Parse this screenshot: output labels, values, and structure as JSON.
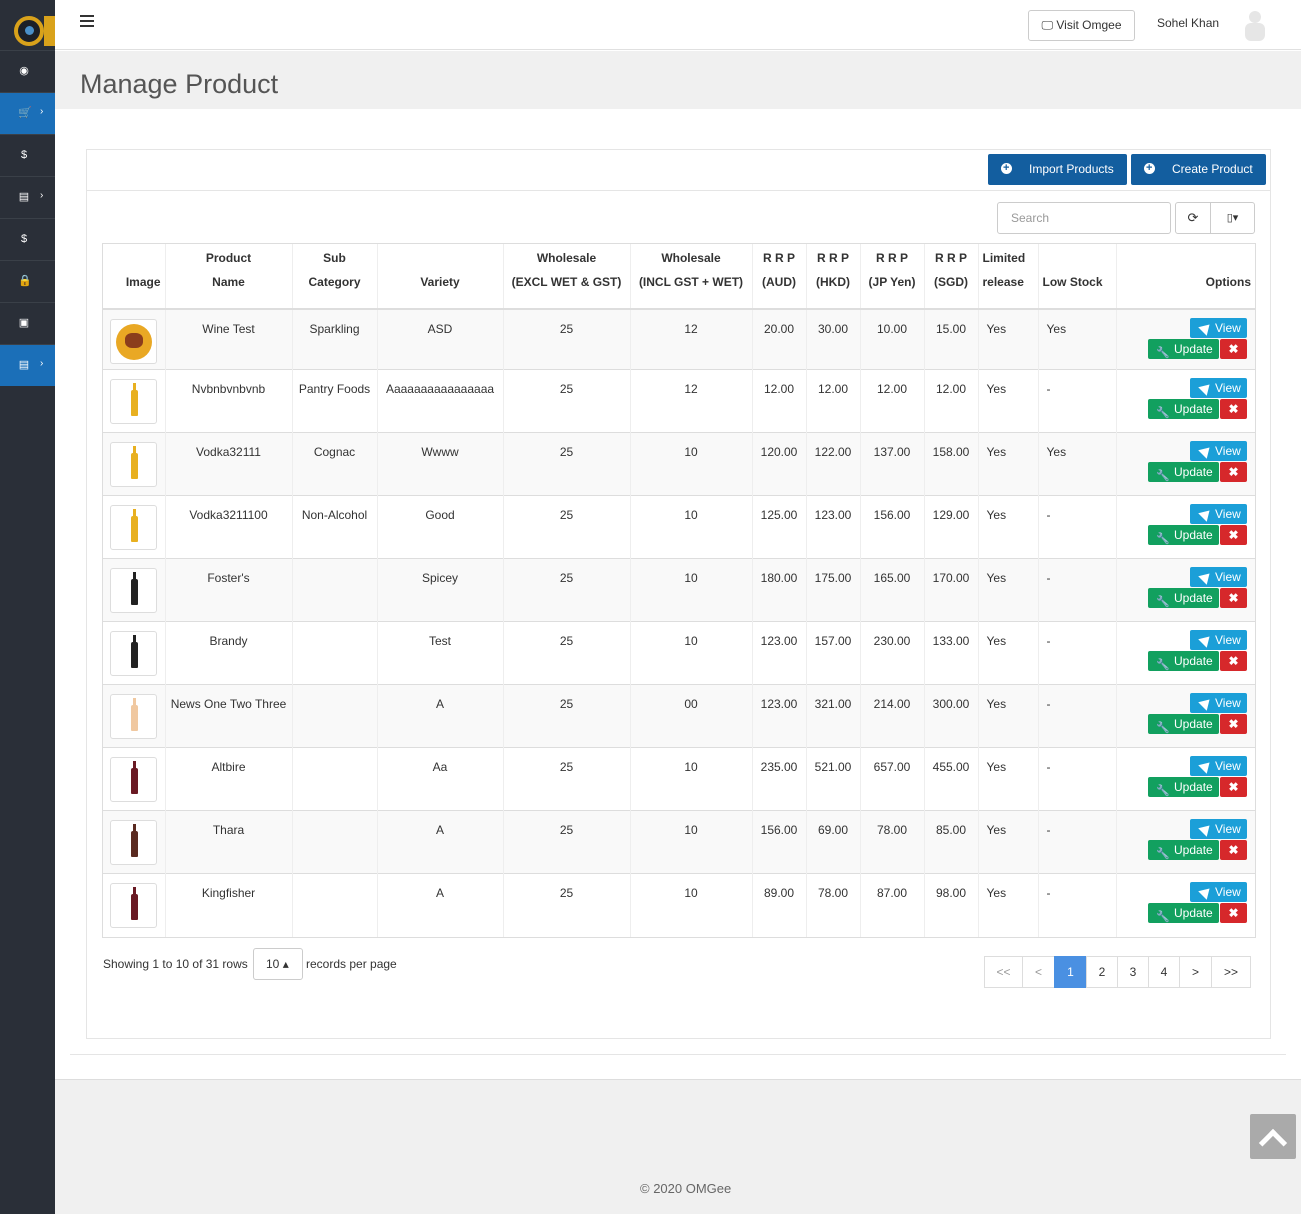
{
  "header": {
    "visit_label": "Visit Omgee",
    "username": "Sohel Khan"
  },
  "sidebar": {
    "items": [
      {
        "icon": "dashboard-icon",
        "glyph": "◉",
        "active": false
      },
      {
        "icon": "cart-icon",
        "glyph": "🛒",
        "active": true,
        "chevron": "›"
      },
      {
        "icon": "dollar-icon",
        "glyph": "$",
        "active": false
      },
      {
        "icon": "file-icon",
        "glyph": "▤",
        "active": false,
        "chevron": "›"
      },
      {
        "icon": "dollar-icon",
        "glyph": "$",
        "active": false
      },
      {
        "icon": "lock-icon",
        "glyph": "🔒",
        "active": false
      },
      {
        "icon": "file-image-icon",
        "glyph": "▣",
        "active": false
      },
      {
        "icon": "file-icon",
        "glyph": "▤",
        "active": true,
        "chevron": "›"
      }
    ]
  },
  "page": {
    "title": "Manage Product",
    "import_label": "Import Products",
    "create_label": "Create Product",
    "search_placeholder": "Search"
  },
  "table": {
    "headers": [
      [
        "",
        "Image"
      ],
      [
        "Product",
        "Name"
      ],
      [
        "Sub",
        "Category"
      ],
      [
        "",
        "Variety"
      ],
      [
        "Wholesale",
        "(EXCL WET & GST)"
      ],
      [
        "Wholesale",
        "(INCL GST + WET)"
      ],
      [
        "R R P",
        "(AUD)"
      ],
      [
        "R R P",
        "(HKD)"
      ],
      [
        "R R P",
        "(JP Yen)"
      ],
      [
        "R R P",
        "(SGD)"
      ],
      [
        "Limited",
        "release"
      ],
      [
        "",
        "Low Stock"
      ],
      [
        "",
        "Options"
      ]
    ],
    "view_label": "View",
    "update_label": "Update",
    "rows": [
      {
        "image": "food-plate",
        "name": "Wine Test",
        "sub": "Sparkling",
        "variety": "ASD",
        "ws_excl": "25",
        "ws_incl": "12",
        "aud": "20.00",
        "hkd": "30.00",
        "jpy": "10.00",
        "sgd": "15.00",
        "limited": "Yes",
        "low": "Yes"
      },
      {
        "image": "bottle-yellow",
        "name": "Nvbnbvnbvnb",
        "sub": "Pantry Foods",
        "variety": "Aaaaaaaaaaaaaaaa",
        "ws_excl": "25",
        "ws_incl": "12",
        "aud": "12.00",
        "hkd": "12.00",
        "jpy": "12.00",
        "sgd": "12.00",
        "limited": "Yes",
        "low": "-"
      },
      {
        "image": "bottle-yellow",
        "name": "Vodka32111",
        "sub": "Cognac",
        "variety": "Wwww",
        "ws_excl": "25",
        "ws_incl": "10",
        "aud": "120.00",
        "hkd": "122.00",
        "jpy": "137.00",
        "sgd": "158.00",
        "limited": "Yes",
        "low": "Yes"
      },
      {
        "image": "bottle-yellow",
        "name": "Vodka3211100",
        "sub": "Non-Alcohol",
        "variety": "Good",
        "ws_excl": "25",
        "ws_incl": "10",
        "aud": "125.00",
        "hkd": "123.00",
        "jpy": "156.00",
        "sgd": "129.00",
        "limited": "Yes",
        "low": "-"
      },
      {
        "image": "bottle-dark",
        "name": "Foster's",
        "sub": "",
        "variety": "Spicey",
        "ws_excl": "25",
        "ws_incl": "10",
        "aud": "180.00",
        "hkd": "175.00",
        "jpy": "165.00",
        "sgd": "170.00",
        "limited": "Yes",
        "low": "-"
      },
      {
        "image": "bottle-dark",
        "name": "Brandy",
        "sub": "",
        "variety": "Test",
        "ws_excl": "25",
        "ws_incl": "10",
        "aud": "123.00",
        "hkd": "157.00",
        "jpy": "230.00",
        "sgd": "133.00",
        "limited": "Yes",
        "low": "-"
      },
      {
        "image": "bottle-rose",
        "name": "News One Two Three",
        "sub": "",
        "variety": "A",
        "ws_excl": "25",
        "ws_incl": "00",
        "aud": "123.00",
        "hkd": "321.00",
        "jpy": "214.00",
        "sgd": "300.00",
        "limited": "Yes",
        "low": "-"
      },
      {
        "image": "bottle-red",
        "name": "Altbire",
        "sub": "",
        "variety": "Aa",
        "ws_excl": "25",
        "ws_incl": "10",
        "aud": "235.00",
        "hkd": "521.00",
        "jpy": "657.00",
        "sgd": "455.00",
        "limited": "Yes",
        "low": "-"
      },
      {
        "image": "bottle-brown",
        "name": "Thara",
        "sub": "",
        "variety": "A",
        "ws_excl": "25",
        "ws_incl": "10",
        "aud": "156.00",
        "hkd": "69.00",
        "jpy": "78.00",
        "sgd": "85.00",
        "limited": "Yes",
        "low": "-"
      },
      {
        "image": "bottle-red",
        "name": "Kingfisher",
        "sub": "",
        "variety": "A",
        "ws_excl": "25",
        "ws_incl": "10",
        "aud": "89.00",
        "hkd": "78.00",
        "jpy": "87.00",
        "sgd": "98.00",
        "limited": "Yes",
        "low": "-"
      }
    ]
  },
  "pagination": {
    "showing": "Showing 1 to 10 of 31 rows",
    "per_page": "10",
    "per_page_label": "records per page",
    "pages": [
      "<<",
      "<",
      "1",
      "2",
      "3",
      "4",
      ">",
      ">>"
    ],
    "current": "1"
  },
  "footer": {
    "copyright": "© 2020 OMGee"
  },
  "colors": {
    "sidebar": "#2a2f38",
    "active_nav": "#1b6fb8",
    "primary": "#135e9f",
    "view": "#1b9fd8",
    "update": "#12a05f",
    "delete": "#d6282b",
    "page_active": "#4a90e2"
  },
  "image_colors": {
    "bottle-yellow": "#e8b020",
    "bottle-dark": "#222222",
    "bottle-rose": "#f0c8a0",
    "bottle-red": "#6a1a24",
    "bottle-brown": "#5a2a20"
  }
}
